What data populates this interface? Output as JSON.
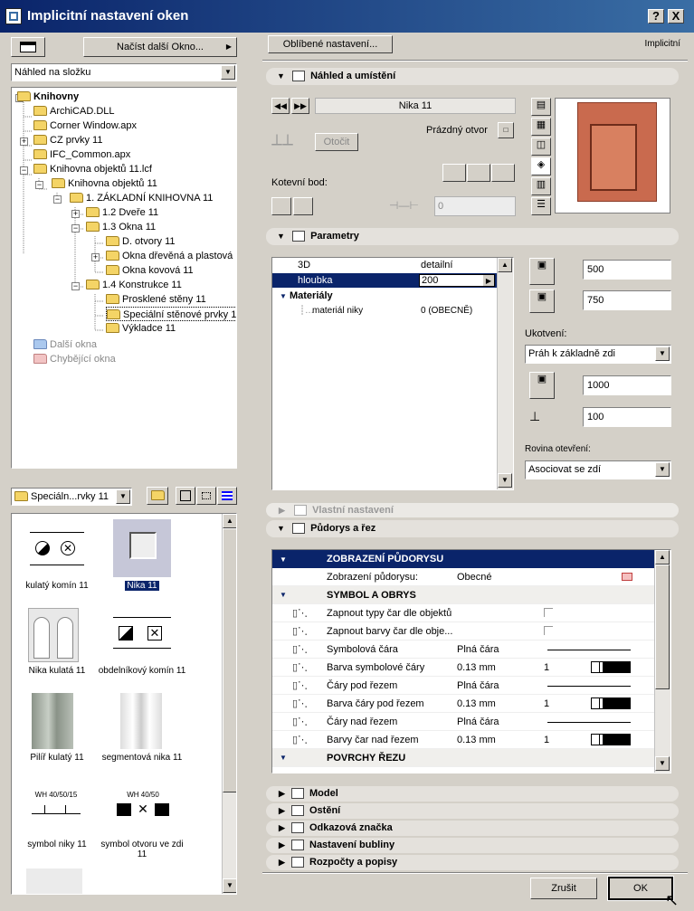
{
  "window": {
    "title": "Implicitní nastavení oken",
    "help": "?",
    "close": "X"
  },
  "left": {
    "load_button": "Načíst další Okno...",
    "view_select": "Náhled na složku",
    "tree": [
      {
        "label": "Knihovny",
        "bold": true
      },
      {
        "label": "ArchiCAD.DLL"
      },
      {
        "label": "Corner Window.apx"
      },
      {
        "label": "CZ prvky 11"
      },
      {
        "label": "IFC_Common.apx"
      },
      {
        "label": "Knihovna objektů 11.lcf"
      },
      {
        "label": "Knihovna objektů 11"
      },
      {
        "label": "1. ZÁKLADNÍ KNIHOVNA 11"
      },
      {
        "label": "1.2 Dveře 11"
      },
      {
        "label": "1.3 Okna 11"
      },
      {
        "label": "D. otvory 11"
      },
      {
        "label": "Okna dřevěná a plastová"
      },
      {
        "label": "Okna kovová 11"
      },
      {
        "label": "1.4 Konstrukce 11"
      },
      {
        "label": "Prosklené stěny 11"
      },
      {
        "label": "Speciální stěnové prvky 11"
      },
      {
        "label": "Výkladce 11"
      },
      {
        "label": "Další okna"
      },
      {
        "label": "Chybějící okna"
      }
    ],
    "folder_select": "Speciáln...rvky 11",
    "thumbs": [
      {
        "label": "kulatý komín 11"
      },
      {
        "label": "Nika 11"
      },
      {
        "label": "Nika kulatá 11"
      },
      {
        "label": "obdelníkový komín 11"
      },
      {
        "label": "Pilíř kulatý 11"
      },
      {
        "label": "segmentová nika 11"
      },
      {
        "label": "symbol niky 11"
      },
      {
        "label": "symbol otvoru ve zdi 11"
      }
    ],
    "thumb_text": {
      "wh1": "WH 40/50/15",
      "wh2": "WH 40/50"
    }
  },
  "right": {
    "fav_button": "Oblíbené nastavení...",
    "implicit": "Implicitní",
    "sec_preview": "Náhled a umístění",
    "name_field": "Nika 11",
    "rotate": "Otočit",
    "empty_opening": "Prázdný otvor",
    "anchor": "Kotevní bod:",
    "anchor_value": "0",
    "sec_params": "Parametry",
    "params": [
      {
        "name": "3D",
        "value": "detailní"
      },
      {
        "name": "hloubka",
        "value": "200"
      },
      {
        "name": "Materiály",
        "value": ""
      },
      {
        "name": "materiál niky",
        "value": "0 (OBECNĚ)"
      }
    ],
    "width": "500",
    "height": "750",
    "anchoring_label": "Ukotvení:",
    "anchoring_value": "Práh k základně zdi",
    "h1": "1000",
    "h2": "100",
    "opening_plane_label": "Rovina otevření:",
    "opening_plane_value": "Asociovat se zdí",
    "sec_custom": "Vlastní nastavení",
    "sec_floorplan": "Půdorys a řez",
    "fp_header": "ZOBRAZENÍ PŮDORYSU",
    "fp_rows": [
      {
        "name": "Zobrazení půdorysu:",
        "value": "Obecné",
        "extra": ""
      },
      {
        "name": "SYMBOL A OBRYS",
        "value": "",
        "extra": ""
      },
      {
        "name": "Zapnout typy čar dle objektů",
        "value": "",
        "extra": ""
      },
      {
        "name": "Zapnout barvy čar dle obje...",
        "value": "",
        "extra": ""
      },
      {
        "name": "Symbolová čára",
        "value": "Plná čára",
        "extra": ""
      },
      {
        "name": "Barva symbolové čáry",
        "value": "0.13 mm",
        "extra": "1"
      },
      {
        "name": "Čáry pod řezem",
        "value": "Plná čára",
        "extra": ""
      },
      {
        "name": "Barva čáry pod řezem",
        "value": "0.13 mm",
        "extra": "1"
      },
      {
        "name": "Čáry nad řezem",
        "value": "Plná čára",
        "extra": ""
      },
      {
        "name": "Barvy čar nad řezem",
        "value": "0.13 mm",
        "extra": "1"
      },
      {
        "name": "POVRCHY ŘEZU",
        "value": "",
        "extra": ""
      }
    ],
    "sections": [
      "Model",
      "Ostění",
      "Odkazová značka",
      "Nastavení bubliny",
      "Rozpočty a popisy"
    ],
    "cancel": "Zrušit",
    "ok": "OK"
  }
}
